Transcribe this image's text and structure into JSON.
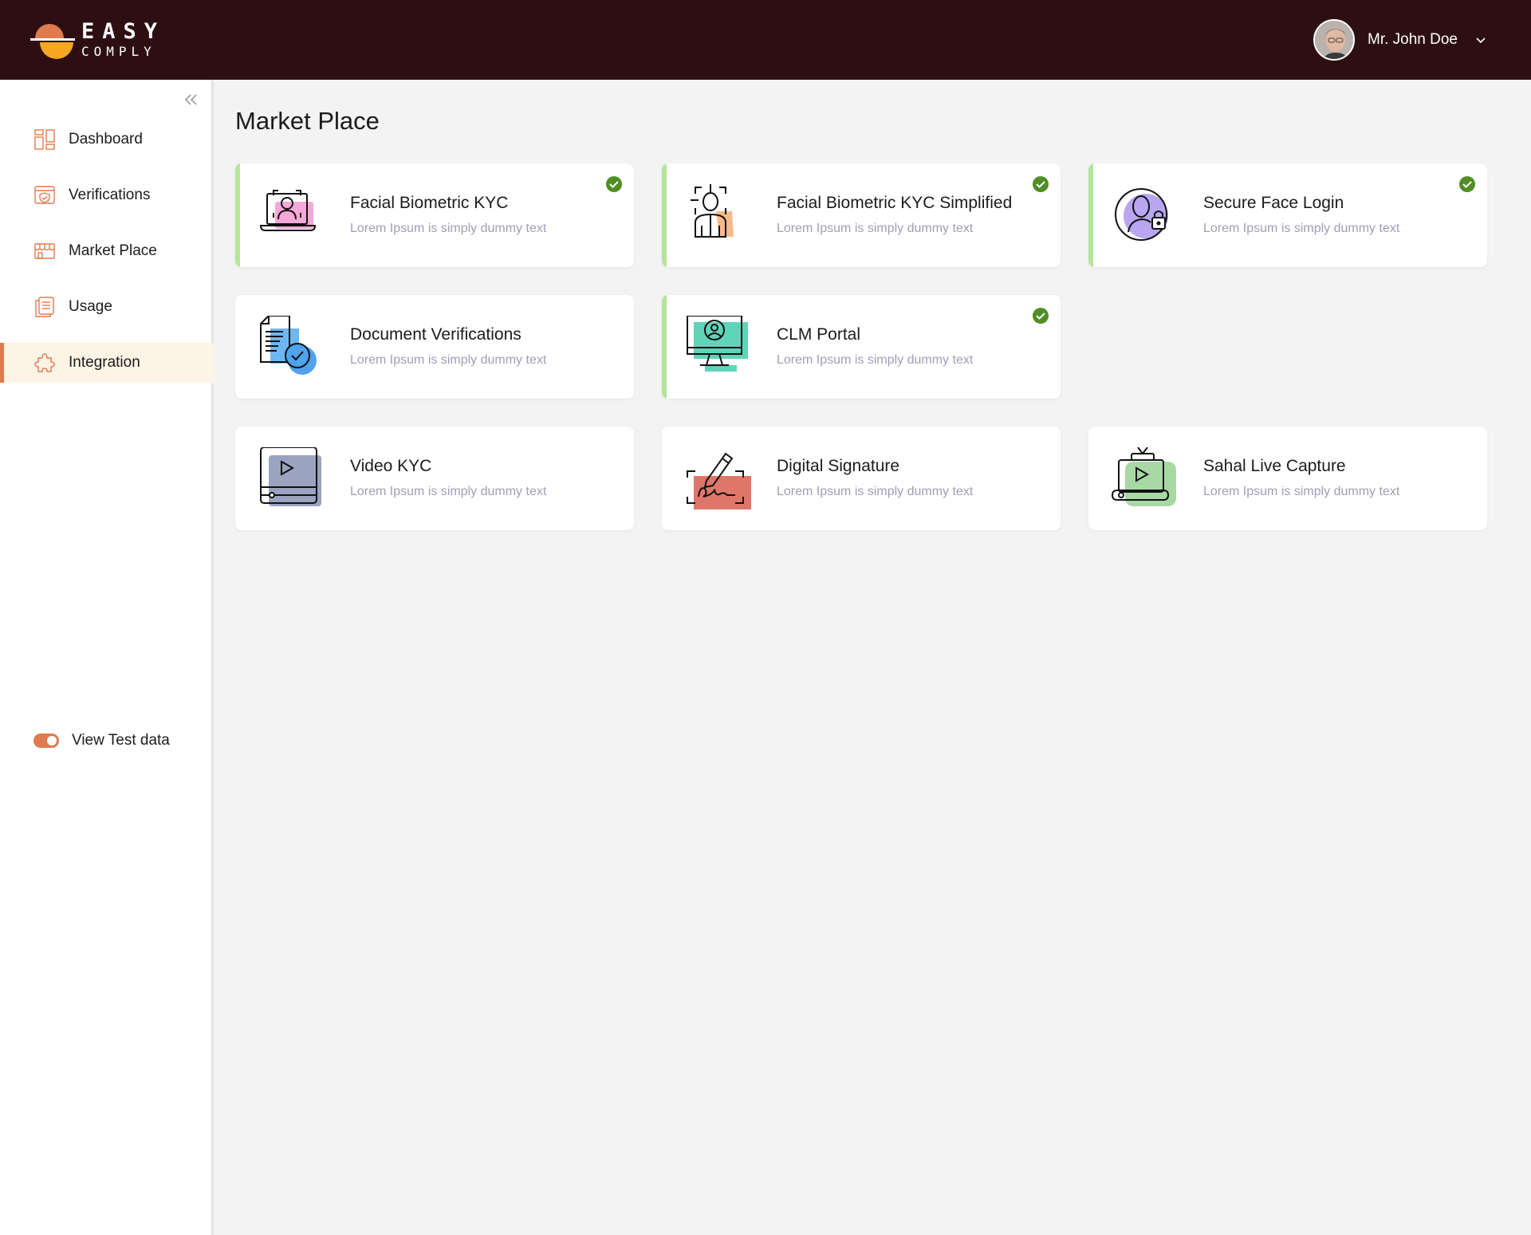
{
  "header": {
    "logo_line1": "EASY",
    "logo_line2": "COMPLY",
    "user_name": "Mr. John Doe"
  },
  "sidebar": {
    "items": [
      {
        "label": "Dashboard",
        "icon": "dashboard-icon"
      },
      {
        "label": "Verifications",
        "icon": "verifications-icon"
      },
      {
        "label": "Market Place",
        "icon": "market-place-icon"
      },
      {
        "label": "Usage",
        "icon": "usage-icon"
      },
      {
        "label": "Integration",
        "icon": "integration-icon",
        "active": true
      }
    ],
    "toggle_label": "View Test data",
    "toggle_on": true
  },
  "main": {
    "title": "Market Place",
    "cards": [
      {
        "title": "Facial Biometric KYC",
        "desc": "Lorem Ipsum is simply dummy text",
        "enabled": true,
        "icon": "facial-biometric-kyc-icon"
      },
      {
        "title": "Facial Biometric KYC Simplified",
        "desc": "Lorem Ipsum is simply dummy text",
        "enabled": true,
        "icon": "facial-biometric-kyc-simplified-icon"
      },
      {
        "title": "Secure Face Login",
        "desc": "Lorem Ipsum is simply dummy text",
        "enabled": true,
        "icon": "secure-face-login-icon"
      },
      {
        "title": "Document Verifications",
        "desc": "Lorem Ipsum is simply dummy text",
        "enabled": false,
        "icon": "document-verifications-icon"
      },
      {
        "title": "CLM Portal",
        "desc": "Lorem Ipsum is simply dummy text",
        "enabled": true,
        "icon": "clm-portal-icon"
      },
      {
        "title": "Video KYC",
        "desc": "Lorem Ipsum is simply dummy text",
        "enabled": false,
        "icon": "video-kyc-icon"
      },
      {
        "title": "Digital Signature",
        "desc": "Lorem Ipsum is simply dummy text",
        "enabled": false,
        "icon": "digital-signature-icon"
      },
      {
        "title": "Sahal Live Capture",
        "desc": "Lorem Ipsum is simply dummy text",
        "enabled": false,
        "icon": "sahal-live-capture-icon"
      }
    ]
  },
  "colors": {
    "header_bg": "#2d0f12",
    "accent": "#e07a4f",
    "enabled_bar": "#b3e59a",
    "check_green": "#4f8f23",
    "active_bg": "#fdf4e6"
  }
}
